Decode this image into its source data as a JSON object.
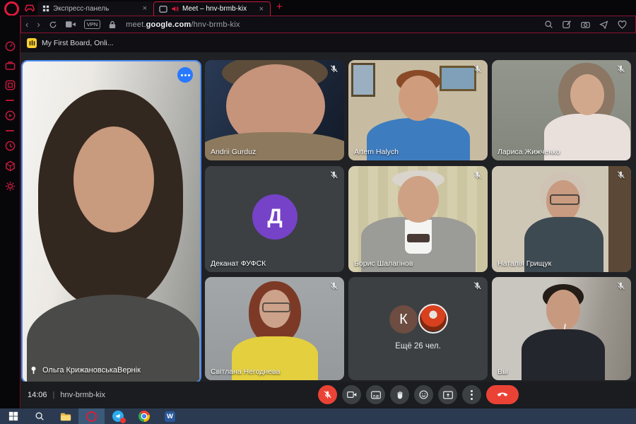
{
  "browser": {
    "tabs": {
      "express": {
        "label": "Экспресс-панель",
        "close": "×"
      },
      "meet": {
        "label": "Meet – hnv-brmb-kix",
        "close": "×"
      },
      "new_tab": "+"
    },
    "nav": {
      "back": "‹",
      "forward": "›"
    },
    "vpn_label": "VPN",
    "url": {
      "pre": "meet.",
      "domain": "google.com",
      "path": "/hnv-brmb-kix"
    }
  },
  "banner": {
    "label": "My First Board, Onli..."
  },
  "meet": {
    "pinned": {
      "name": "Ольга КрижановськаВернік"
    },
    "tiles": [
      {
        "name": "Andrii Gurduz"
      },
      {
        "name": "Artem Halych"
      },
      {
        "name": "Лариса Жижченко"
      },
      {
        "name": "Деканат ФУФСК",
        "avatar_letter": "Д"
      },
      {
        "name": "Борис Шалагінов"
      },
      {
        "name": "Наталія Грищук"
      },
      {
        "name": "Світлана Негоднева"
      },
      {
        "name": "Ещё 26 чел.",
        "avatar_letter": "К"
      },
      {
        "name": "Вы"
      }
    ],
    "footer": {
      "time": "14:06",
      "divider": "|",
      "code": "hnv-brmb-kix"
    }
  },
  "taskbar": {
    "word_letter": "W"
  },
  "colors": {
    "gx_red": "#e01a3c",
    "meet_bg": "#202124",
    "tile_bg": "#3c4043",
    "pinned_border": "#4e8cf0",
    "danger_red": "#ea4335",
    "avatar_purple": "#7642c8",
    "avatar_brown": "#6d4c41",
    "telegram_blue": "#2aabee",
    "taskbar_bg": "#2b3a50",
    "miro_yellow": "#ffd02f"
  }
}
